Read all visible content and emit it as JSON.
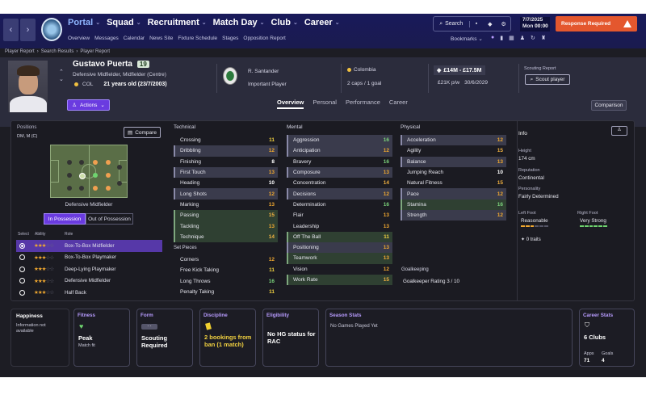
{
  "nav": {
    "back": "‹",
    "forward": "›",
    "menu": [
      {
        "label": "Portal",
        "active": true
      },
      {
        "label": "Squad"
      },
      {
        "label": "Recruitment"
      },
      {
        "label": "Match Day"
      },
      {
        "label": "Club"
      },
      {
        "label": "Career"
      }
    ],
    "submenu": [
      "Overview",
      "Messages",
      "Calendar",
      "News Site",
      "Fixture Schedule",
      "Stages",
      "Opposition Report"
    ],
    "search_label": "Search",
    "bookmarks_label": "Bookmarks",
    "date": "7/7/2025",
    "day": "Mon",
    "time": "00:00",
    "continue_label": "Response Required"
  },
  "breadcrumb": [
    "Player Report",
    "›",
    "Search Results",
    "›",
    "Player Report"
  ],
  "player": {
    "name": "Gustavo Puerta",
    "number": "19",
    "position": "Defensive Midfielder, Midfielder (Centre)",
    "nationality_code": "COL",
    "age": "21 years old (23/7/2003)",
    "actions_label": "Actions",
    "club": "R. Santander",
    "role_status": "Important Player",
    "country": "Colombia",
    "caps": "2 caps / 1 goal",
    "value": "£14M - £17.5M",
    "wage": "£21K p/w",
    "contract": "30/6/2029",
    "scouting_label": "Scouting Report",
    "scout_button": "Scout player"
  },
  "tabs": [
    {
      "label": "Overview",
      "active": true
    },
    {
      "label": "Personal"
    },
    {
      "label": "Performance"
    },
    {
      "label": "Career"
    }
  ],
  "compare_label": "Comparison",
  "positions": {
    "label": "Positions",
    "value": "DM, M (C)",
    "compare_label": "Compare",
    "current_role": "Defensive Midfielder",
    "in_possession": "In Possession",
    "out_possession": "Out of Possession",
    "headers": [
      "Select",
      "Ability",
      "Role"
    ],
    "roles": [
      {
        "name": "Box-To-Box Midfielder",
        "stars": 2.5,
        "selected": true
      },
      {
        "name": "Box-To-Box Playmaker",
        "stars": 2.5
      },
      {
        "name": "Deep-Lying Playmaker",
        "stars": 2.5
      },
      {
        "name": "Defensive Midfielder",
        "stars": 2.5
      },
      {
        "name": "Half Back",
        "stars": 2.5
      }
    ]
  },
  "technical": {
    "title": "Technical",
    "rows": [
      {
        "name": "Crossing",
        "value": 11,
        "style": "blank"
      },
      {
        "name": "Dribbling",
        "value": 12,
        "style": "hl"
      },
      {
        "name": "Finishing",
        "value": 8,
        "style": "blank"
      },
      {
        "name": "First Touch",
        "value": 13,
        "style": "hl"
      },
      {
        "name": "Heading",
        "value": 10,
        "style": "blank"
      },
      {
        "name": "Long Shots",
        "value": 12,
        "style": "hl"
      },
      {
        "name": "Marking",
        "value": 13,
        "style": "blank"
      },
      {
        "name": "Passing",
        "value": 15,
        "style": "gr"
      },
      {
        "name": "Tackling",
        "value": 13,
        "style": "gr"
      },
      {
        "name": "Technique",
        "value": 14,
        "style": "gr"
      }
    ]
  },
  "set_pieces": {
    "title": "Set Pieces",
    "rows": [
      {
        "name": "Corners",
        "value": 12,
        "style": "blank"
      },
      {
        "name": "Free Kick Taking",
        "value": 11,
        "style": "blank"
      },
      {
        "name": "Long Throws",
        "value": 16,
        "style": "blank"
      },
      {
        "name": "Penalty Taking",
        "value": 11,
        "style": "blank"
      }
    ]
  },
  "mental": {
    "title": "Mental",
    "rows": [
      {
        "name": "Aggression",
        "value": 16,
        "style": "hl"
      },
      {
        "name": "Anticipation",
        "value": 12,
        "style": "hl"
      },
      {
        "name": "Bravery",
        "value": 16,
        "style": "blank"
      },
      {
        "name": "Composure",
        "value": 13,
        "style": "hl"
      },
      {
        "name": "Concentration",
        "value": 14,
        "style": "blank"
      },
      {
        "name": "Decisions",
        "value": 12,
        "style": "hl"
      },
      {
        "name": "Determination",
        "value": 16,
        "style": "blank"
      },
      {
        "name": "Flair",
        "value": 13,
        "style": "blank"
      },
      {
        "name": "Leadership",
        "value": 13,
        "style": "blank"
      },
      {
        "name": "Off The Ball",
        "value": 11,
        "style": "gr"
      },
      {
        "name": "Positioning",
        "value": 13,
        "style": "hl"
      },
      {
        "name": "Teamwork",
        "value": 13,
        "style": "gr"
      },
      {
        "name": "Vision",
        "value": 12,
        "style": "blank"
      },
      {
        "name": "Work Rate",
        "value": 15,
        "style": "gr"
      }
    ]
  },
  "physical": {
    "title": "Physical",
    "rows": [
      {
        "name": "Acceleration",
        "value": 12,
        "style": "hl"
      },
      {
        "name": "Agility",
        "value": 15,
        "style": "blank"
      },
      {
        "name": "Balance",
        "value": 13,
        "style": "hl"
      },
      {
        "name": "Jumping Reach",
        "value": 10,
        "style": "blank"
      },
      {
        "name": "Natural Fitness",
        "value": 15,
        "style": "blank"
      },
      {
        "name": "Pace",
        "value": 12,
        "style": "hl"
      },
      {
        "name": "Stamina",
        "value": 16,
        "style": "gr"
      },
      {
        "name": "Strength",
        "value": 12,
        "style": "hl"
      }
    ]
  },
  "goalkeeping": {
    "title": "Goalkeeping",
    "rating": "Goalkeeper Rating  3 / 10"
  },
  "info": {
    "title": "Info",
    "height_label": "Height",
    "height": "174 cm",
    "reputation_label": "Reputation",
    "reputation": "Continental",
    "personality_label": "Personality",
    "personality": "Fairly Determined",
    "left_foot_label": "Left Foot",
    "left_foot": "Reasonable",
    "left_foot_level": 0.5,
    "right_foot_label": "Right Foot",
    "right_foot": "Very Strong",
    "right_foot_level": 1.0,
    "traits": "0 traits"
  },
  "cards": {
    "happiness_title": "Happiness",
    "happiness_text": "Information not available",
    "fitness_title": "Fitness",
    "fitness_value": "Peak",
    "fitness_sub": "Match fit",
    "form_title": "Form",
    "form_badge": "- -",
    "form_value": "Scouting Required",
    "discipline_title": "Discipline",
    "discipline_value": "2 bookings from ban (1 match)",
    "eligibility_title": "Eligibility",
    "eligibility_value": "No HG status for RAC",
    "season_title": "Season Stats",
    "season_value": "No Games Played Yet",
    "career_title": "Career Stats",
    "career_value": "6 Clubs",
    "apps_label": "Apps",
    "apps": "71",
    "goals_label": "Goals",
    "goals": "4"
  },
  "colors": {
    "accent": "#6a3be0",
    "continue": "#e4572e",
    "nav": "#1a1b4f"
  }
}
